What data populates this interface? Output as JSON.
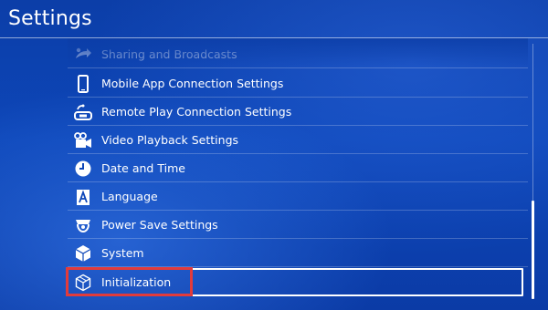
{
  "header": {
    "title": "Settings"
  },
  "settings": {
    "items": [
      {
        "label": "Sharing and Broadcasts",
        "icon": "share-icon",
        "state": "dim"
      },
      {
        "label": "Mobile App Connection Settings",
        "icon": "smartphone-icon",
        "state": "normal"
      },
      {
        "label": "Remote Play Connection Settings",
        "icon": "remote-play-icon",
        "state": "normal"
      },
      {
        "label": "Video Playback Settings",
        "icon": "video-camera-icon",
        "state": "normal"
      },
      {
        "label": "Date and Time",
        "icon": "clock-icon",
        "state": "normal"
      },
      {
        "label": "Language",
        "icon": "language-icon",
        "state": "normal"
      },
      {
        "label": "Power Save Settings",
        "icon": "power-save-icon",
        "state": "normal"
      },
      {
        "label": "System",
        "icon": "system-cube-icon",
        "state": "normal"
      },
      {
        "label": "Initialization",
        "icon": "initialization-cube-icon",
        "state": "selected"
      }
    ]
  },
  "colors": {
    "background": "#0d46b8",
    "text": "#ffffff",
    "highlight": "#e23b3b"
  }
}
